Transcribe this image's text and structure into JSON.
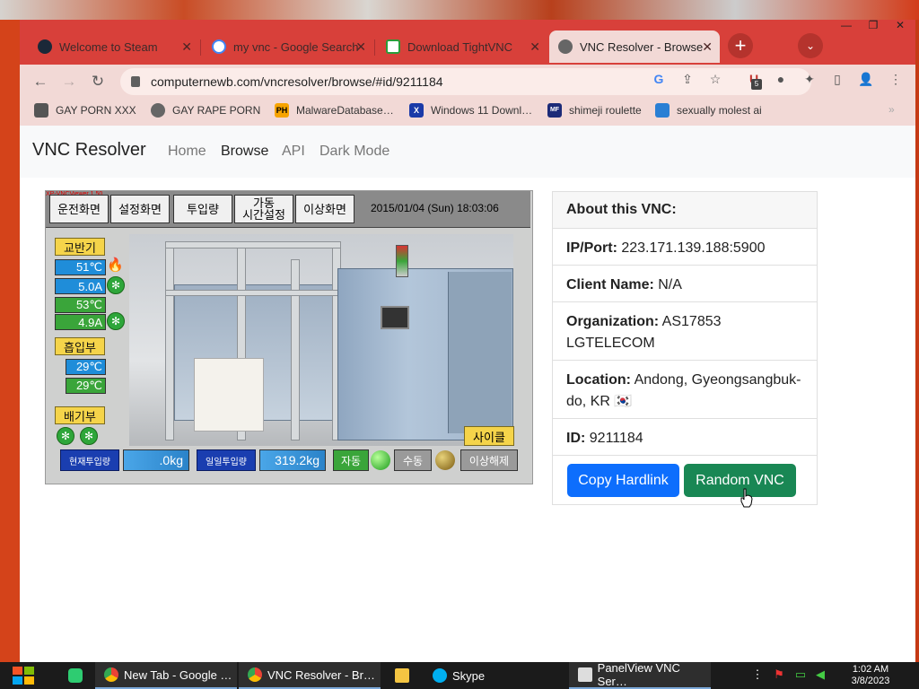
{
  "browser": {
    "tabs": [
      {
        "title": "Welcome to Steam",
        "icon": "steam-icon"
      },
      {
        "title": "my vnc - Google Search",
        "icon": "google-icon"
      },
      {
        "title": "Download TightVNC",
        "icon": "tightvnc-icon"
      },
      {
        "title": "VNC Resolver - Browse",
        "icon": "vnc-resolver-icon"
      }
    ],
    "close_glyph": "✕",
    "new_tab_glyph": "+",
    "tab_list_glyph": "⌄",
    "url": "computernewb.com/vncresolver/browse/#id/9211184",
    "extension_badge": "5",
    "bookmarks": [
      {
        "label": "GAY PORN XXX",
        "icon": "bookmark-icon"
      },
      {
        "label": "GAY RAPE PORN",
        "icon": "globe-icon"
      },
      {
        "label": "MalwareDatabase…",
        "icon": "ph-icon",
        "icon_text": "PH"
      },
      {
        "label": "Windows 11 Downl…",
        "icon": "x-icon",
        "icon_text": "X"
      },
      {
        "label": "shimeji roulette",
        "icon": "mf-icon",
        "icon_text": "MF"
      },
      {
        "label": "sexually molest ai",
        "icon": "bookmark-app-icon"
      }
    ]
  },
  "site": {
    "brand": "VNC Resolver",
    "nav": [
      "Home",
      "Browse",
      "API",
      "Dark Mode"
    ],
    "active_nav": "Browse"
  },
  "vnc": {
    "viewer_tag": "XP-VNCViewer 1.50",
    "buttons": [
      "운전화면",
      "설정화면",
      "투입량",
      "가동\n시간설정",
      "이상화면"
    ],
    "datetime": "2015/01/04 (Sun) 18:03:06",
    "sections": {
      "mixer": "교반기",
      "intake": "흡입부",
      "exhaust": "배기부"
    },
    "values": {
      "temp1": "51℃",
      "amp1": "5.0A",
      "temp2": "53℃",
      "amp2": "4.9A",
      "intake1": "29℃",
      "intake2": "29℃"
    },
    "cycle": "사이클",
    "bottom": {
      "current_input_label": "현재투입량",
      "current_input_value": ".0kg",
      "daily_input_label": "일일투입량",
      "daily_input_value": "319.2kg",
      "auto": "자동",
      "manual": "수동",
      "reset": "이상해제"
    }
  },
  "card": {
    "header": "About this VNC:",
    "fields": [
      {
        "label": "IP/Port:",
        "value": "223.171.139.188:5900"
      },
      {
        "label": "Client Name:",
        "value": "N/A"
      },
      {
        "label": "Organization:",
        "value": "AS17853 LGTELECOM"
      },
      {
        "label": "Location:",
        "value": "Andong, Gyeongsangbuk-do, KR 🇰🇷"
      },
      {
        "label": "ID:",
        "value": "9211184"
      }
    ],
    "copy_button": "Copy Hardlink",
    "random_button": "Random VNC"
  },
  "taskbar": {
    "items": [
      {
        "label": "New Tab - Google …",
        "icon": "chrome-icon"
      },
      {
        "label": "VNC Resolver - Br…",
        "icon": "chrome-icon"
      },
      {
        "label": "",
        "icon": "folder-icon"
      },
      {
        "label": "Skype",
        "icon": "skype-icon"
      },
      {
        "label": "PanelView VNC Ser…",
        "icon": "panelview-icon"
      }
    ],
    "time": "1:02 AM",
    "date": "3/8/2023"
  },
  "colors": {
    "tabstrip": "#d8403a",
    "primary": "#0d6efd",
    "success": "#198754"
  }
}
